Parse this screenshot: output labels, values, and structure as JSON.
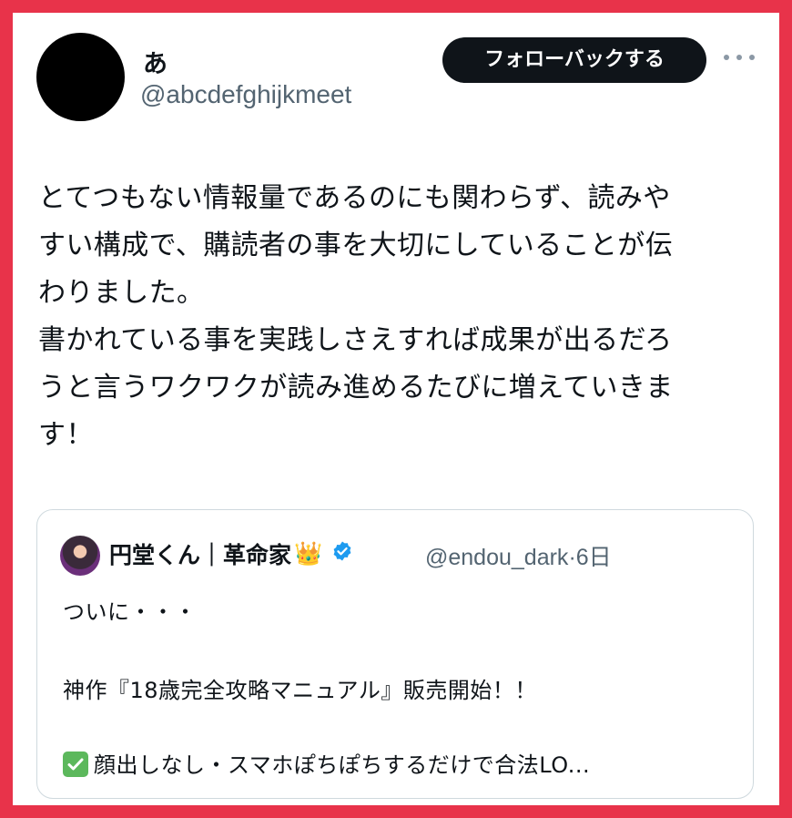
{
  "tweet": {
    "author_name": "あ",
    "author_handle": "@abcdefghijkmeet",
    "follow_button": "フォローバックする",
    "lines": [
      "とてつもない情報量であるのにも関わらず、読みや",
      "すい構成で、購読者の事を大切にしていることが伝",
      "わりました。",
      "書かれている事を実践しさえすれば成果が出るだろ",
      "うと言うワクワクが読み進めるたびに増えていきま",
      "す！"
    ]
  },
  "quoted": {
    "author_name": "円堂くん｜革命家",
    "crown_icon": "👑",
    "author_handle": "@endou_dark",
    "time": "·6日",
    "line1": "ついに・・・",
    "line2": "神作『18歳完全攻略マニュアル』販売開始！！",
    "line3": "顔出しなし・スマホぽちぽちするだけで合法LO..."
  },
  "colors": {
    "frame": "#e8334a",
    "verified": "#1d9bf0",
    "check": "#5cb85c"
  }
}
